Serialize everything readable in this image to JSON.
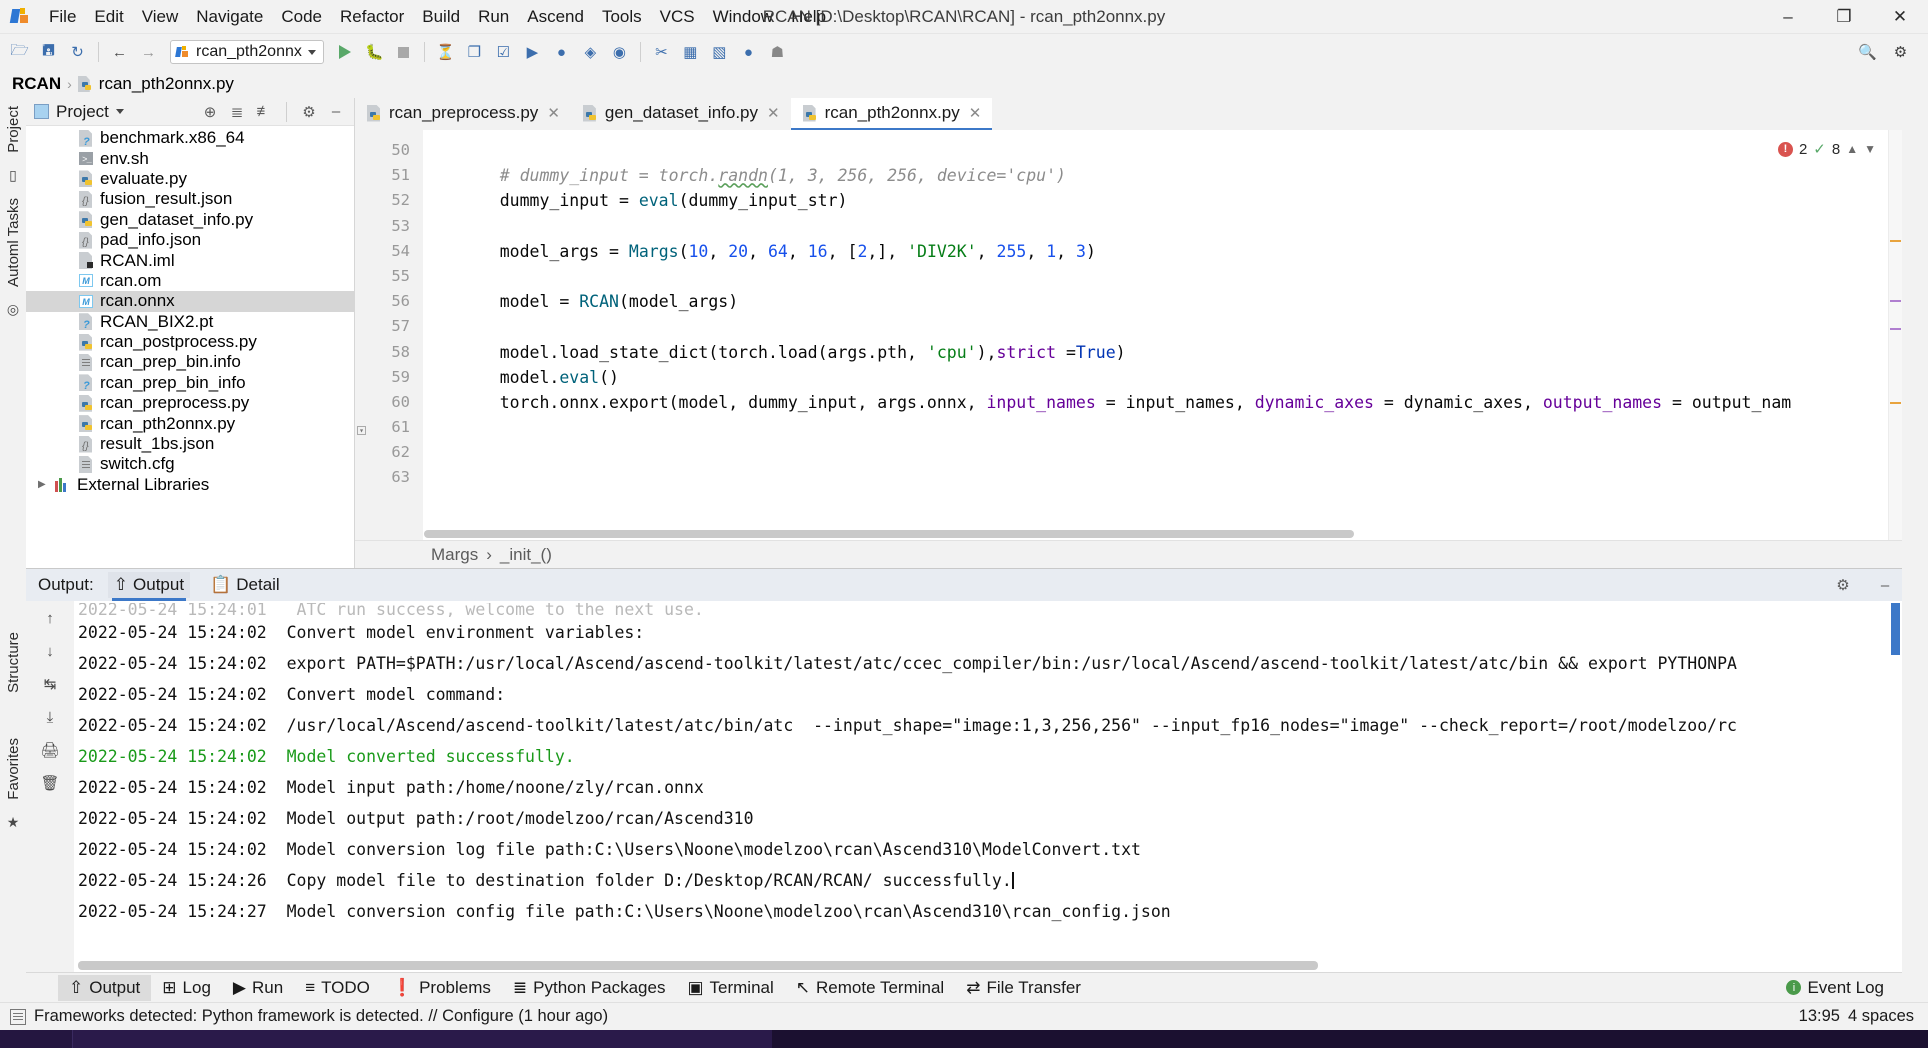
{
  "window": {
    "title": "RCAN [D:\\Desktop\\RCAN\\RCAN] - rcan_pth2onnx.py",
    "minimize": "–",
    "maximize": "❐",
    "close": "✕"
  },
  "menu": [
    "File",
    "Edit",
    "View",
    "Navigate",
    "Code",
    "Refactor",
    "Build",
    "Run",
    "Ascend",
    "Tools",
    "VCS",
    "Window",
    "Help"
  ],
  "toolbar": {
    "run_config": "rcan_pth2onnx",
    "icons": [
      "open-folder-icon",
      "save-icon",
      "sync-icon",
      "back-arrow-icon",
      "forward-arrow-icon"
    ],
    "right_icons": [
      "search-icon",
      "settings-gear-icon"
    ]
  },
  "breadcrumb": {
    "root": "RCAN",
    "separator": "›",
    "file": "rcan_pth2onnx.py"
  },
  "left_rail": [
    "Project",
    "Automl Tasks",
    "Structure",
    "Favorites"
  ],
  "project_panel": {
    "title": "Project",
    "tree": [
      {
        "label": "benchmark.x86_64",
        "icon": "unknown-file-icon",
        "type": "q",
        "selected": false
      },
      {
        "label": "env.sh",
        "icon": "shell-script-icon",
        "type": "sh",
        "selected": false
      },
      {
        "label": "evaluate.py",
        "icon": "python-file-icon",
        "type": "py",
        "selected": false
      },
      {
        "label": "fusion_result.json",
        "icon": "json-file-icon",
        "type": "json",
        "selected": false
      },
      {
        "label": "gen_dataset_info.py",
        "icon": "python-file-icon",
        "type": "py",
        "selected": false
      },
      {
        "label": "pad_info.json",
        "icon": "json-file-icon",
        "type": "json",
        "selected": false
      },
      {
        "label": "RCAN.iml",
        "icon": "iml-file-icon",
        "type": "iml",
        "selected": false
      },
      {
        "label": "rcan.om",
        "icon": "modified-file-icon",
        "type": "m",
        "selected": false
      },
      {
        "label": "rcan.onnx",
        "icon": "modified-file-icon",
        "type": "m",
        "selected": true
      },
      {
        "label": "RCAN_BIX2.pt",
        "icon": "unknown-file-icon",
        "type": "q",
        "selected": false
      },
      {
        "label": "rcan_postprocess.py",
        "icon": "python-file-icon",
        "type": "py",
        "selected": false
      },
      {
        "label": "rcan_prep_bin.info",
        "icon": "text-file-icon",
        "type": "txt",
        "selected": false
      },
      {
        "label": "rcan_prep_bin_info",
        "icon": "unknown-file-icon",
        "type": "q",
        "selected": false
      },
      {
        "label": "rcan_preprocess.py",
        "icon": "python-file-icon",
        "type": "py",
        "selected": false
      },
      {
        "label": "rcan_pth2onnx.py",
        "icon": "python-file-icon",
        "type": "py",
        "selected": false
      },
      {
        "label": "result_1bs.json",
        "icon": "json-file-icon",
        "type": "json",
        "selected": false
      },
      {
        "label": "switch.cfg",
        "icon": "text-file-icon",
        "type": "txt",
        "selected": false
      }
    ],
    "external_libraries": "External Libraries"
  },
  "editor": {
    "tabs": [
      {
        "label": "rcan_preprocess.py",
        "active": false
      },
      {
        "label": "gen_dataset_info.py",
        "active": false
      },
      {
        "label": "rcan_pth2onnx.py",
        "active": true
      }
    ],
    "line_numbers": [
      "50",
      "51",
      "52",
      "53",
      "54",
      "55",
      "56",
      "57",
      "58",
      "59",
      "60",
      "61",
      "62",
      "63"
    ],
    "inspection": {
      "errors": "2",
      "warnings": "8"
    },
    "breadcrumb_class": "Margs",
    "breadcrumb_sep": "›",
    "breadcrumb_method": "_init_()",
    "code_lines": [
      "",
      "    # dummy_input = torch.randn(1, 3, 256, 256, device='cpu')",
      "    dummy_input = eval(dummy_input_str)",
      "",
      "    model_args = Margs(10, 20, 64, 16, [2,], 'DIV2K', 255, 1, 3)",
      "",
      "    model = RCAN(model_args)",
      "",
      "    model.load_state_dict(torch.load(args.pth, 'cpu'),strict=True)",
      "    model.eval()",
      "    torch.onnx.export(model, dummy_input, args.onnx, input_names = input_names, dynamic_axes = dynamic_axes, output_names = output_nam",
      "",
      "",
      ""
    ]
  },
  "output_window": {
    "label": "Output:",
    "tabs": [
      {
        "label": "Output",
        "icon": "output-upload-icon",
        "active": true
      },
      {
        "label": "Detail",
        "icon": "detail-clipboard-icon",
        "active": false
      }
    ],
    "settings_icon": "gear-icon",
    "minimize_icon": "minimize-icon",
    "rail_icons": [
      "scroll-up-icon",
      "scroll-down-icon",
      "soft-wrap-icon",
      "download-icon",
      "print-icon",
      "trash-icon"
    ],
    "log_lines": [
      {
        "time": "",
        "text": "2022-05-24 15:24:01   ATC run success, welcome to the next use.",
        "color": "muted",
        "partial": true
      },
      {
        "time": "2022-05-24 15:24:02",
        "text": "Convert model environment variables:",
        "color": "normal"
      },
      {
        "time": "2022-05-24 15:24:02",
        "text": "export PATH=$PATH:/usr/local/Ascend/ascend-toolkit/latest/atc/ccec_compiler/bin:/usr/local/Ascend/ascend-toolkit/latest/atc/bin && export PYTHONPA",
        "color": "normal"
      },
      {
        "time": "2022-05-24 15:24:02",
        "text": "Convert model command:",
        "color": "normal"
      },
      {
        "time": "2022-05-24 15:24:02",
        "text": "/usr/local/Ascend/ascend-toolkit/latest/atc/bin/atc  --input_shape=\"image:1,3,256,256\" --input_fp16_nodes=\"image\" --check_report=/root/modelzoo/rc",
        "color": "normal"
      },
      {
        "time": "2022-05-24 15:24:02",
        "text": "Model converted successfully.",
        "color": "green"
      },
      {
        "time": "2022-05-24 15:24:02",
        "text": "Model input path:/home/noone/zly/rcan.onnx",
        "color": "normal"
      },
      {
        "time": "2022-05-24 15:24:02",
        "text": "Model output path:/root/modelzoo/rcan/Ascend310",
        "color": "normal"
      },
      {
        "time": "2022-05-24 15:24:02",
        "text": "Model conversion log file path:C:\\Users\\Noone\\modelzoo\\rcan\\Ascend310\\ModelConvert.txt",
        "color": "normal"
      },
      {
        "time": "2022-05-24 15:24:26",
        "text": "Copy model file to destination folder D:/Desktop/RCAN/RCAN/ successfully.",
        "color": "normal",
        "caret": true
      },
      {
        "time": "2022-05-24 15:24:27",
        "text": "Model conversion config file path:C:\\Users\\Noone\\modelzoo\\rcan\\Ascend310\\rcan_config.json",
        "color": "normal"
      }
    ]
  },
  "bottom_tabs": [
    {
      "label": "Output",
      "icon": "output-upload-icon",
      "active": true
    },
    {
      "label": "Log",
      "icon": "plus-box-icon",
      "active": false
    },
    {
      "label": "Run",
      "icon": "run-play-icon",
      "active": false
    },
    {
      "label": "TODO",
      "icon": "todo-list-icon",
      "active": false
    },
    {
      "label": "Problems",
      "icon": "problems-alert-icon",
      "active": false
    },
    {
      "label": "Python Packages",
      "icon": "packages-icon",
      "active": false
    },
    {
      "label": "Terminal",
      "icon": "terminal-icon",
      "active": false
    },
    {
      "label": "Remote Terminal",
      "icon": "remote-terminal-icon",
      "active": false
    },
    {
      "label": "File Transfer",
      "icon": "file-transfer-icon",
      "active": false
    }
  ],
  "event_log": {
    "label": "Event Log",
    "icon": "event-log-icon"
  },
  "statusbar": {
    "message": "Frameworks detected: Python framework is detected. // Configure (1 hour ago)",
    "caret_position": "13:95",
    "indent": "4 spaces"
  },
  "colors": {
    "accent_blue": "#3c78c8",
    "success_green": "#1a9a1a",
    "error_red": "#d9534f",
    "string_green": "#067d17",
    "keyword_blue": "#0033b3",
    "number_blue": "#1750eb",
    "param_purple": "#660099"
  }
}
